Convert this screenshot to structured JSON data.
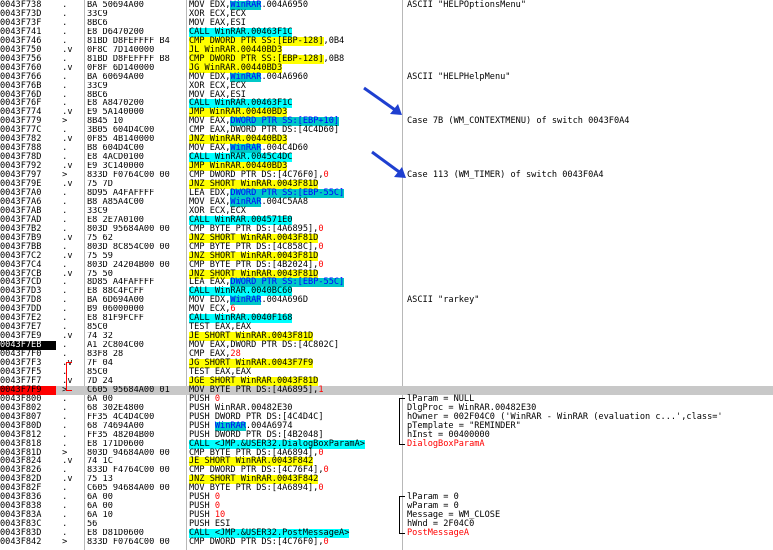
{
  "rows": [
    {
      "a": "0043F738",
      "f": ".",
      "h": "BA 50694A00",
      "d": [
        [
          "MOV EDX,",
          ""
        ],
        [
          "WinRAR",
          "mem"
        ],
        [
          ".004A6950",
          ""
        ]
      ],
      "c": "ASCII \"HELPOptionsMenu\""
    },
    {
      "a": "0043F73D",
      "f": ".",
      "h": "33C9",
      "d": [
        [
          "XOR ECX,ECX",
          ""
        ]
      ]
    },
    {
      "a": "0043F73F",
      "f": ".",
      "h": "8BC6",
      "d": [
        [
          "MOV EAX,ESI",
          ""
        ]
      ]
    },
    {
      "a": "0043F741",
      "f": ".",
      "h": "E8 D6470200",
      "d": [
        [
          "CALL WinRAR.00463F1C",
          "call"
        ]
      ]
    },
    {
      "a": "0043F746",
      "f": ".",
      "h": "81BD D8FEFFFF B4",
      "d": [
        [
          "CMP DWORD PTR SS:[EBP-128]",
          "jmp"
        ],
        [
          ",0B4",
          ""
        ]
      ]
    },
    {
      "a": "0043F750",
      "f": ".v",
      "h": "0F8C 7D140000",
      "d": [
        [
          "JL WinRAR.00440BD3",
          "jmp"
        ]
      ]
    },
    {
      "a": "0043F756",
      "f": ".",
      "h": "81BD D8FEFFFF B8",
      "d": [
        [
          "CMP DWORD PTR SS:[EBP-128]",
          "jmp"
        ],
        [
          ",0B8",
          ""
        ]
      ]
    },
    {
      "a": "0043F760",
      "f": ".v",
      "h": "0F8F 6D140000",
      "d": [
        [
          "JG WinRAR.00440BD3",
          "jmp"
        ]
      ]
    },
    {
      "a": "0043F766",
      "f": ".",
      "h": "BA 60694A00",
      "d": [
        [
          "MOV EDX,",
          ""
        ],
        [
          "WinRAR",
          "mem"
        ],
        [
          ".004A6960",
          ""
        ]
      ],
      "c": "ASCII \"HELPHelpMenu\""
    },
    {
      "a": "0043F76B",
      "f": ".",
      "h": "33C9",
      "d": [
        [
          "XOR ECX,ECX",
          ""
        ]
      ]
    },
    {
      "a": "0043F76D",
      "f": ".",
      "h": "8BC6",
      "d": [
        [
          "MOV EAX,ESI",
          ""
        ]
      ]
    },
    {
      "a": "0043F76F",
      "f": ".",
      "h": "E8 A8470200",
      "d": [
        [
          "CALL WinRAR.00463F1C",
          "call"
        ]
      ]
    },
    {
      "a": "0043F774",
      "f": ".v",
      "h": "E9 5A140000",
      "d": [
        [
          "JMP WinRAR.00440BD3",
          "jmp"
        ]
      ]
    },
    {
      "a": "0043F779",
      "f": ">",
      "h": "8B45 10",
      "d": [
        [
          "MOV EAX,",
          ""
        ],
        [
          "DWORD PTR SS:[EBP+10]",
          "mem"
        ]
      ],
      "c": "Case 7B (WM_CONTEXTMENU) of switch 0043F0A4"
    },
    {
      "a": "0043F77C",
      "f": ".",
      "h": "3B05 604D4C00",
      "d": [
        [
          "CMP EAX,DWORD PTR DS:[4C4D60]",
          ""
        ]
      ]
    },
    {
      "a": "0043F782",
      "f": ".v",
      "h": "0F85 4B140000",
      "d": [
        [
          "JNZ WinRAR.00440BD3",
          "jmp"
        ]
      ]
    },
    {
      "a": "0043F788",
      "f": ".",
      "h": "B8 604D4C00",
      "d": [
        [
          "MOV EAX,",
          ""
        ],
        [
          "WinRAR",
          "mem"
        ],
        [
          ".004C4D60",
          ""
        ]
      ]
    },
    {
      "a": "0043F78D",
      "f": ".",
      "h": "E8 4ACD0100",
      "d": [
        [
          "CALL WinRAR.0045C4DC",
          "call"
        ]
      ]
    },
    {
      "a": "0043F792",
      "f": ".v",
      "h": "E9 3C140000",
      "d": [
        [
          "JMP WinRAR.00440BD3",
          "jmp"
        ]
      ]
    },
    {
      "a": "0043F797",
      "f": ">",
      "h": "833D F0764C00 00",
      "d": [
        [
          "CMP DWORD PTR DS:[4C76F0],",
          ""
        ],
        [
          "0",
          "red"
        ]
      ],
      "c": "Case 113 (WM_TIMER) of switch 0043F0A4"
    },
    {
      "a": "0043F79E",
      "f": ".v",
      "h": "75 7D",
      "d": [
        [
          "JNZ SHORT WinRAR.0043F81D",
          "jmp"
        ]
      ]
    },
    {
      "a": "0043F7A0",
      "f": ".",
      "h": "8D95 A4FAFFFF",
      "d": [
        [
          "LEA EDX,",
          ""
        ],
        [
          "DWORD PTR SS:[EBP-55C]",
          "mem"
        ]
      ]
    },
    {
      "a": "0043F7A6",
      "f": ".",
      "h": "B8 A85A4C00",
      "d": [
        [
          "MOV EAX,",
          ""
        ],
        [
          "WinRAR",
          "mem"
        ],
        [
          ".004C5AA8",
          ""
        ]
      ]
    },
    {
      "a": "0043F7AB",
      "f": ".",
      "h": "33C9",
      "d": [
        [
          "XOR ECX,ECX",
          ""
        ]
      ]
    },
    {
      "a": "0043F7AD",
      "f": ".",
      "h": "E8 2E7A0100",
      "d": [
        [
          "CALL WinRAR.004571E0",
          "call"
        ]
      ]
    },
    {
      "a": "0043F7B2",
      "f": ".",
      "h": "803D 95684A00 00",
      "d": [
        [
          "CMP BYTE PTR DS:[4A6895],",
          ""
        ],
        [
          "0",
          "red"
        ]
      ]
    },
    {
      "a": "0043F7B9",
      "f": ".v",
      "h": "75 62",
      "d": [
        [
          "JNZ SHORT WinRAR.0043F81D",
          "jmp"
        ]
      ]
    },
    {
      "a": "0043F7BB",
      "f": ".",
      "h": "803D 8C854C00 00",
      "d": [
        [
          "CMP BYTE PTR DS:[4C858C],",
          ""
        ],
        [
          "0",
          "red"
        ]
      ]
    },
    {
      "a": "0043F7C2",
      "f": ".v",
      "h": "75 59",
      "d": [
        [
          "JNZ SHORT WinRAR.0043F81D",
          "jmp"
        ]
      ]
    },
    {
      "a": "0043F7C4",
      "f": ".",
      "h": "803D 24204B00 00",
      "d": [
        [
          "CMP BYTE PTR DS:[4B2024],",
          ""
        ],
        [
          "0",
          "red"
        ]
      ]
    },
    {
      "a": "0043F7CB",
      "f": ".v",
      "h": "75 50",
      "d": [
        [
          "JNZ SHORT WinRAR.0043F81D",
          "jmp"
        ]
      ]
    },
    {
      "a": "0043F7CD",
      "f": ".",
      "h": "8D85 A4FAFFFF",
      "d": [
        [
          "LEA EAX,",
          ""
        ],
        [
          "DWORD PTR SS:[EBP-55C]",
          "mem"
        ]
      ]
    },
    {
      "a": "0043F7D3",
      "f": ".",
      "h": "E8 88C4FCFF",
      "d": [
        [
          "CALL WinRAR.0040BC60",
          "call"
        ]
      ]
    },
    {
      "a": "0043F7D8",
      "f": ".",
      "h": "BA 6D694A00",
      "d": [
        [
          "MOV EDX,",
          ""
        ],
        [
          "WinRAR",
          "mem"
        ],
        [
          ".004A696D",
          ""
        ]
      ],
      "c": "ASCII \"rarkey\""
    },
    {
      "a": "0043F7DD",
      "f": ".",
      "h": "B9 06000000",
      "d": [
        [
          "MOV ECX,",
          ""
        ],
        [
          "6",
          "red"
        ]
      ]
    },
    {
      "a": "0043F7E2",
      "f": ".",
      "h": "E8 81F9FCFF",
      "d": [
        [
          "CALL WinRAR.0040F168",
          "call"
        ]
      ]
    },
    {
      "a": "0043F7E7",
      "f": ".",
      "h": "85C0",
      "d": [
        [
          "TEST EAX,EAX",
          ""
        ]
      ]
    },
    {
      "a": "0043F7E9",
      "f": ".v",
      "h": "74 32",
      "d": [
        [
          "JE SHORT WinRAR.0043F81D",
          "jmp"
        ]
      ]
    },
    {
      "a": "0043F7EB",
      "f": ".",
      "h": "A1 2C804C00",
      "d": [
        [
          "MOV EAX,DWORD PTR DS:[4C802C]",
          ""
        ]
      ],
      "cur": true
    },
    {
      "a": "0043F7F0",
      "f": ".",
      "h": "83F8 28",
      "d": [
        [
          "CMP EAX,",
          ""
        ],
        [
          "28",
          "red"
        ]
      ]
    },
    {
      "a": "0043F7F3",
      "f": ".v",
      "h": "7F 04",
      "d": [
        [
          "JG SHORT WinRAR.0043F7F9",
          "jmp"
        ]
      ]
    },
    {
      "a": "0043F7F5",
      "f": ".",
      "h": "85C0",
      "d": [
        [
          "TEST EAX,EAX",
          ""
        ]
      ]
    },
    {
      "a": "0043F7F7",
      "f": ".v",
      "h": "7D 24",
      "d": [
        [
          "JGE SHORT WinRAR.0043F81D",
          "jmp"
        ]
      ]
    },
    {
      "a": "0043F7F9",
      "f": ">",
      "h": "C605 95684A00 01",
      "d": [
        [
          "MOV BYTE PTR DS:[4A6895],",
          ""
        ],
        [
          "1",
          "red"
        ]
      ],
      "bp": true,
      "sel": true
    },
    {
      "a": "0043F800",
      "f": ".",
      "h": "6A 00",
      "d": [
        [
          "PUSH ",
          ""
        ],
        [
          "0",
          "red"
        ]
      ],
      "c": "lParam = NULL"
    },
    {
      "a": "0043F802",
      "f": ".",
      "h": "68 302E4800",
      "d": [
        [
          "PUSH WinRAR.00482E30",
          ""
        ]
      ],
      "c": "DlgProc = WinRAR.00482E30"
    },
    {
      "a": "0043F807",
      "f": ".",
      "h": "FF35 4C4D4C00",
      "d": [
        [
          "PUSH DWORD PTR DS:[4C4D4C]",
          ""
        ]
      ],
      "c": "hOwner = 002F04C0 ('WinRAR - WinRAR (evaluation c...',class='"
    },
    {
      "a": "0043F80D",
      "f": ".",
      "h": "68 74694A00",
      "d": [
        [
          "PUSH ",
          ""
        ],
        [
          "WinRAR",
          "mem"
        ],
        [
          ".004A6974",
          ""
        ]
      ],
      "c": "pTemplate = \"REMINDER\""
    },
    {
      "a": "0043F812",
      "f": ".",
      "h": "FF35 48204B00",
      "d": [
        [
          "PUSH DWORD PTR DS:[4B2048]",
          ""
        ]
      ],
      "c": "hInst = 00400000"
    },
    {
      "a": "0043F818",
      "f": ".",
      "h": "E8 171D0600",
      "d": [
        [
          "CALL <JMP.&USER32.DialogBoxParamA>",
          "call"
        ]
      ],
      "c": "DialogBoxParamA",
      "cr": true
    },
    {
      "a": "0043F81D",
      "f": ">",
      "h": "803D 94684A00 00",
      "d": [
        [
          "CMP BYTE PTR DS:[4A6894],",
          ""
        ],
        [
          "0",
          "red"
        ]
      ]
    },
    {
      "a": "0043F824",
      "f": ".v",
      "h": "74 1C",
      "d": [
        [
          "JE SHORT WinRAR.0043F842",
          "jmp"
        ]
      ]
    },
    {
      "a": "0043F826",
      "f": ".",
      "h": "833D F4764C00 00",
      "d": [
        [
          "CMP DWORD PTR DS:[4C76F4],",
          ""
        ],
        [
          "0",
          "red"
        ]
      ]
    },
    {
      "a": "0043F82D",
      "f": ".v",
      "h": "75 13",
      "d": [
        [
          "JNZ SHORT WinRAR.0043F842",
          "jmp"
        ]
      ]
    },
    {
      "a": "0043F82F",
      "f": ".",
      "h": "C605 94684A00 00",
      "d": [
        [
          "MOV BYTE PTR DS:[4A6894],",
          ""
        ],
        [
          "0",
          "red"
        ]
      ]
    },
    {
      "a": "0043F836",
      "f": ".",
      "h": "6A 00",
      "d": [
        [
          "PUSH ",
          ""
        ],
        [
          "0",
          "red"
        ]
      ],
      "c": "lParam = 0"
    },
    {
      "a": "0043F838",
      "f": ".",
      "h": "6A 00",
      "d": [
        [
          "PUSH ",
          ""
        ],
        [
          "0",
          "red"
        ]
      ],
      "c": "wParam = 0"
    },
    {
      "a": "0043F83A",
      "f": ".",
      "h": "6A 10",
      "d": [
        [
          "PUSH ",
          ""
        ],
        [
          "10",
          "red"
        ]
      ],
      "c": "Message = WM_CLOSE"
    },
    {
      "a": "0043F83C",
      "f": ".",
      "h": "56",
      "d": [
        [
          "PUSH ESI",
          ""
        ]
      ],
      "c": "hWnd = 2F04C0"
    },
    {
      "a": "0043F83D",
      "f": ".",
      "h": "E8 D81D0600",
      "d": [
        [
          "CALL <JMP.&USER32.PostMessageA>",
          "call"
        ]
      ],
      "c": "PostMessageA",
      "cr": true
    },
    {
      "a": "0043F842",
      "f": ">",
      "h": "833D F0764C00 00",
      "d": [
        [
          "CMP DWORD PTR DS:[4C76F0],",
          ""
        ],
        [
          "0",
          "red"
        ]
      ]
    }
  ],
  "colors": {
    "jump_highlight": "#ffff00",
    "call_highlight": "#00ffff",
    "memory_highlight": "#00c8c8",
    "breakpoint": "#ff0000",
    "current_eip": "#000000",
    "selection": "#c8c8c8",
    "annotation_arrow": "#1e3fd0"
  }
}
